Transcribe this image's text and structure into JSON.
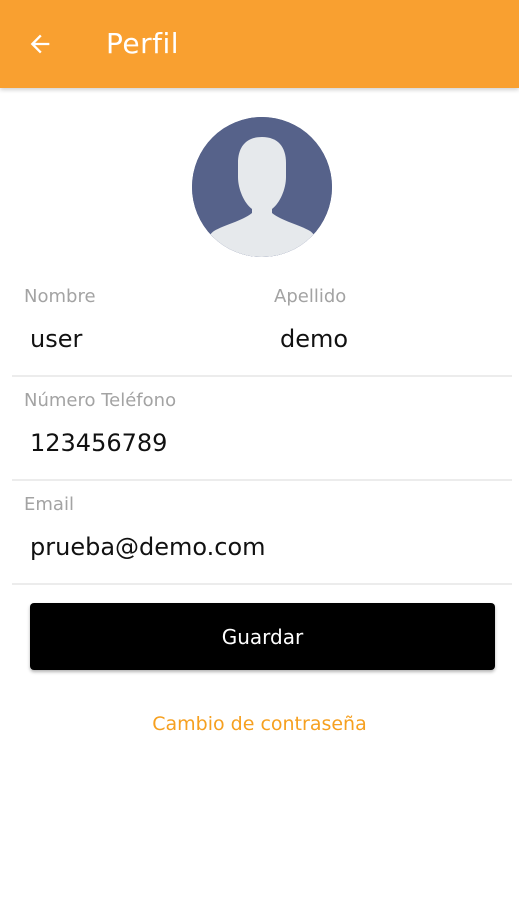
{
  "appbar": {
    "title": "Perfil",
    "back_icon": "arrow-left-icon",
    "color": "#f9a030"
  },
  "avatar": {
    "icon": "user-silhouette-icon",
    "background": "#56628a"
  },
  "form": {
    "first_name": {
      "label": "Nombre",
      "value": "user"
    },
    "last_name": {
      "label": "Apellido",
      "value": "demo"
    },
    "phone": {
      "label": "Número Teléfono",
      "value": "123456789"
    },
    "email": {
      "label": "Email",
      "value": "prueba@demo.com"
    }
  },
  "actions": {
    "save_label": "Guardar",
    "change_password_label": "Cambio de contraseña"
  }
}
